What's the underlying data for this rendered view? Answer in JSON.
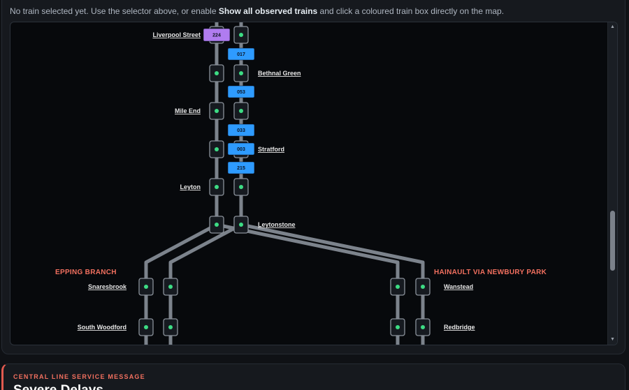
{
  "hint": {
    "prefix": "No train selected yet. Use the selector above, or enable ",
    "bold": "Show all observed trains",
    "suffix": " and click a coloured train box directly on the map."
  },
  "map": {
    "stations": [
      {
        "name": "Liverpool Street",
        "side": "left"
      },
      {
        "name": "Bethnal Green",
        "side": "right"
      },
      {
        "name": "Mile End",
        "side": "left"
      },
      {
        "name": "Stratford",
        "side": "right"
      },
      {
        "name": "Leyton",
        "side": "left"
      },
      {
        "name": "Leytonstone",
        "side": "right"
      },
      {
        "name": "Snaresbrook",
        "side": "left"
      },
      {
        "name": "South Woodford",
        "side": "left"
      },
      {
        "name": "Wanstead",
        "side": "right"
      },
      {
        "name": "Redbridge",
        "side": "right"
      }
    ],
    "branches": {
      "left": "EPPING BRANCH",
      "right": "HAINAULT VIA NEWBURY PARK"
    },
    "trains": [
      {
        "id": "224",
        "color": "#b07cf0"
      },
      {
        "id": "017",
        "color": "#2e9bff"
      },
      {
        "id": "053",
        "color": "#2e9bff"
      },
      {
        "id": "033",
        "color": "#2e9bff"
      },
      {
        "id": "003",
        "color": "#2e9bff"
      },
      {
        "id": "215",
        "color": "#2e9bff"
      }
    ],
    "colors": {
      "track": "#7c838c",
      "node_fill": "#161a20",
      "node_stroke": "#8a919a",
      "node_dot": "#3ddc84"
    }
  },
  "message": {
    "kicker": "CENTRAL LINE SERVICE MESSAGE",
    "title": "Severe Delays"
  }
}
